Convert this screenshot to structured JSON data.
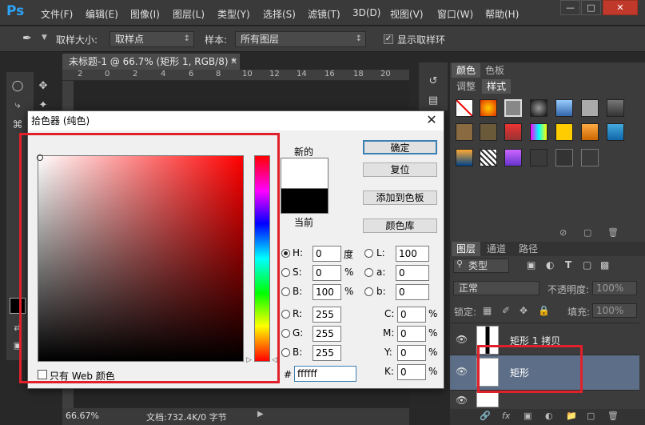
{
  "app": {
    "logo": "Ps",
    "window_buttons": [
      "—",
      "□",
      "✕"
    ]
  },
  "menu": [
    "文件(F)",
    "编辑(E)",
    "图像(I)",
    "图层(L)",
    "类型(Y)",
    "选择(S)",
    "滤镜(T)",
    "3D(D)",
    "视图(V)",
    "窗口(W)",
    "帮助(H)"
  ],
  "options": {
    "sample_size_label": "取样大小:",
    "sample_size_value": "取样点",
    "sample_label": "样本:",
    "sample_value": "所有图层",
    "show_ring_label": "显示取样环",
    "show_ring_checked": true
  },
  "document": {
    "tab": "未标题-1 @ 66.7% (矩形 1, RGB/8) *",
    "ruler_ticks": [
      "2",
      "0",
      "2",
      "4",
      "6",
      "8",
      "10",
      "12",
      "14",
      "16",
      "18",
      "20"
    ],
    "zoom": "66.67%",
    "doc_info": "文档:732.4K/0 字节"
  },
  "panels": {
    "color_tabs": [
      "颜色",
      "色板"
    ],
    "style_tabs": [
      "调整",
      "样式"
    ],
    "layer_tabs": [
      "图层",
      "通道",
      "路径"
    ],
    "kind_filter": "类型",
    "blend_mode": "正常",
    "opacity_label": "不透明度:",
    "opacity_value": "100%",
    "lock_label": "锁定:",
    "fill_label": "填充:",
    "fill_value": "100%",
    "layers": [
      "矩形 1 拷贝",
      "矩形",
      ""
    ]
  },
  "dialog": {
    "title": "拾色器 (纯色)",
    "new_label": "新的",
    "current_label": "当前",
    "buttons": {
      "ok": "确定",
      "reset": "复位",
      "add_swatch": "添加到色板",
      "color_libraries": "颜色库"
    },
    "web_only_label": "只有 Web 颜色",
    "hsb": [
      {
        "label": "H:",
        "value": "0",
        "unit": "度",
        "selected": true
      },
      {
        "label": "S:",
        "value": "0",
        "unit": "%",
        "selected": false
      },
      {
        "label": "B:",
        "value": "100",
        "unit": "%",
        "selected": false
      }
    ],
    "rgb": [
      {
        "label": "R:",
        "value": "255"
      },
      {
        "label": "G:",
        "value": "255"
      },
      {
        "label": "B:",
        "value": "255"
      }
    ],
    "lab": [
      {
        "label": "L:",
        "value": "100"
      },
      {
        "label": "a:",
        "value": "0"
      },
      {
        "label": "b:",
        "value": "0"
      }
    ],
    "cmyk": [
      {
        "label": "C:",
        "value": "0",
        "unit": "%"
      },
      {
        "label": "M:",
        "value": "0",
        "unit": "%"
      },
      {
        "label": "Y:",
        "value": "0",
        "unit": "%"
      },
      {
        "label": "K:",
        "value": "0",
        "unit": "%"
      }
    ],
    "hex_label": "#",
    "hex_value": "ffffff",
    "new_color": "#ffffff",
    "current_color": "#000000"
  },
  "colors": {
    "highlight": "#e0202a",
    "ps_blue": "#2fa3f7"
  }
}
